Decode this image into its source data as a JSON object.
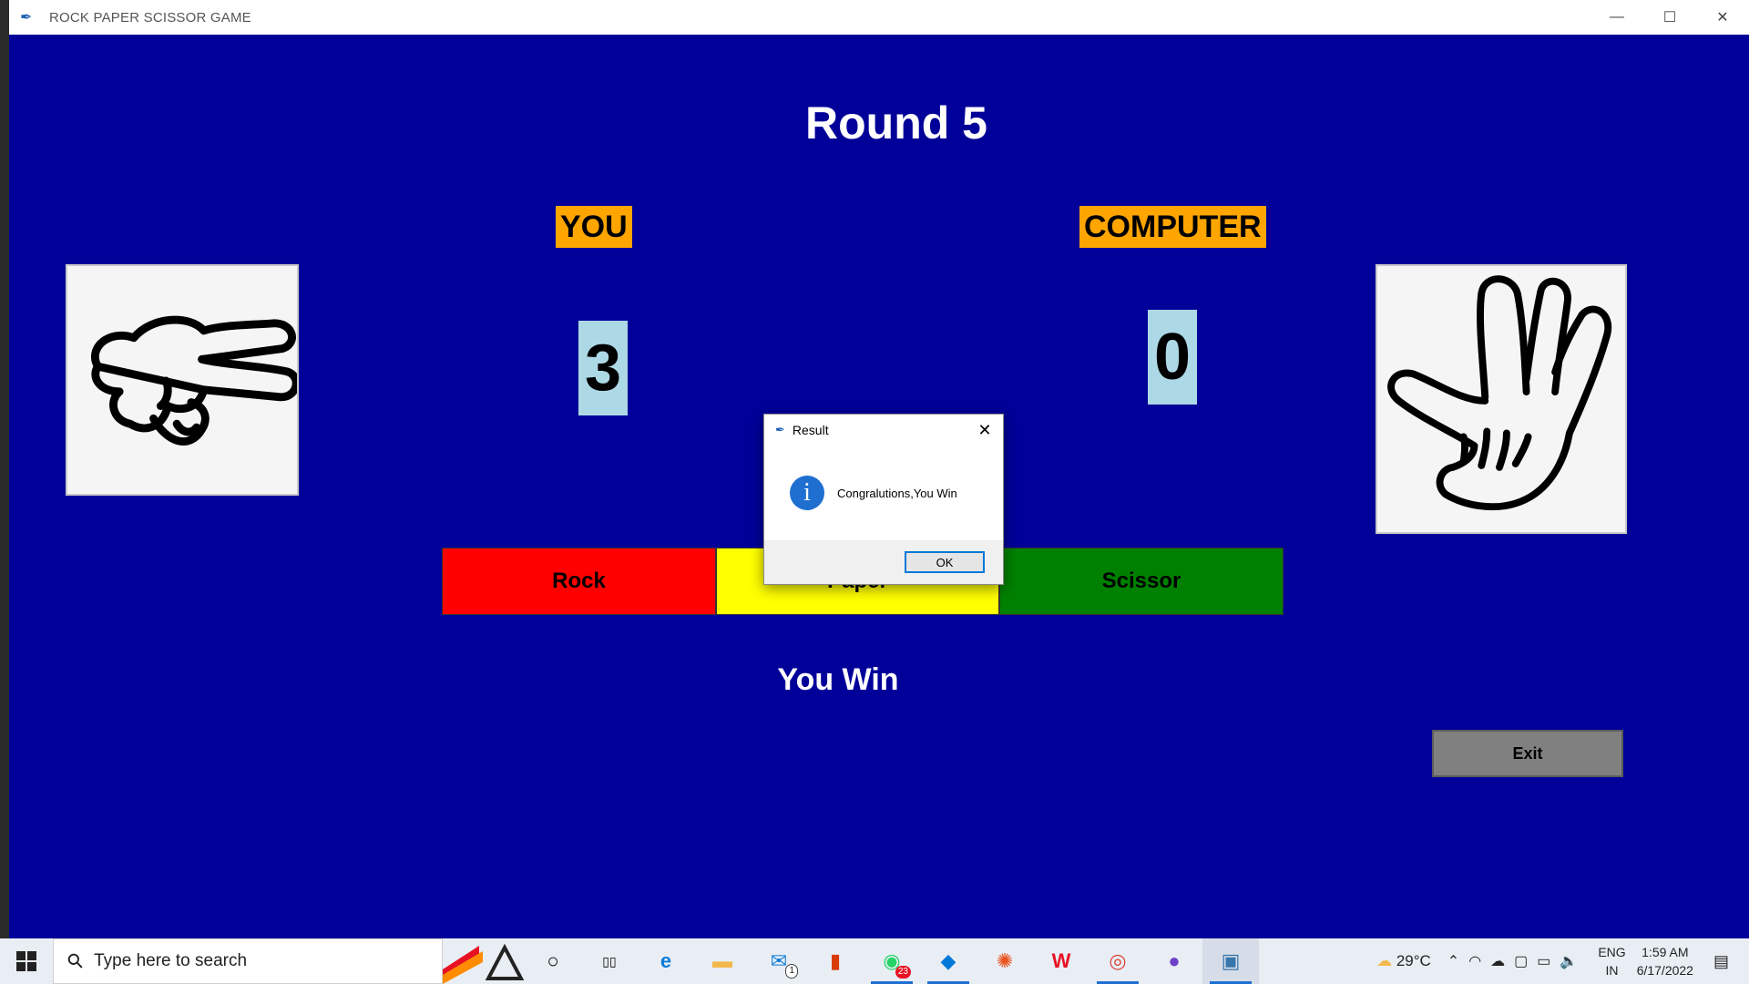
{
  "window": {
    "title": "ROCK PAPER SCISSOR GAME",
    "controls": {
      "minimize": "—",
      "maximize": "☐",
      "close": "✕"
    }
  },
  "game": {
    "round_title": "Round 5",
    "player_label": "YOU",
    "computer_label": "COMPUTER",
    "player_score": "3",
    "computer_score": "0",
    "player_choice_icon": "scissor-hand-icon",
    "computer_choice_icon": "paper-hand-icon",
    "buttons": {
      "rock": "Rock",
      "paper": "Paper",
      "scissor": "Scissor"
    },
    "result_text": "You Win",
    "exit_label": "Exit",
    "colors": {
      "background": "#010199",
      "label_bg": "#ffa500",
      "score_bg": "#add8e6",
      "rock": "#ff0000",
      "paper": "#ffff00",
      "scissor": "#008000",
      "exit": "#808080"
    }
  },
  "dialog": {
    "title": "Result",
    "close": "✕",
    "icon": "info-icon",
    "message": "Congralutions,You Win",
    "ok_label": "OK"
  },
  "taskbar": {
    "search_placeholder": "Type here to search",
    "apps": [
      {
        "name": "cortana",
        "icon": "○"
      },
      {
        "name": "task-view",
        "icon": "▯▯"
      },
      {
        "name": "edge",
        "icon": "e"
      },
      {
        "name": "file-explorer",
        "icon": "▬"
      },
      {
        "name": "mail",
        "icon": "✉",
        "badge": "1"
      },
      {
        "name": "office",
        "icon": "▮"
      },
      {
        "name": "whatsapp",
        "icon": "◉",
        "badge": "23"
      },
      {
        "name": "vscode",
        "icon": "◆"
      },
      {
        "name": "ubuntu",
        "icon": "✺"
      },
      {
        "name": "wps",
        "icon": "W"
      },
      {
        "name": "chrome",
        "icon": "◎"
      },
      {
        "name": "github",
        "icon": "●"
      },
      {
        "name": "python",
        "icon": "▣"
      }
    ],
    "weather": "29°C",
    "lang_top": "ENG",
    "lang_bottom": "IN",
    "time": "1:59 AM",
    "date": "6/17/2022"
  }
}
